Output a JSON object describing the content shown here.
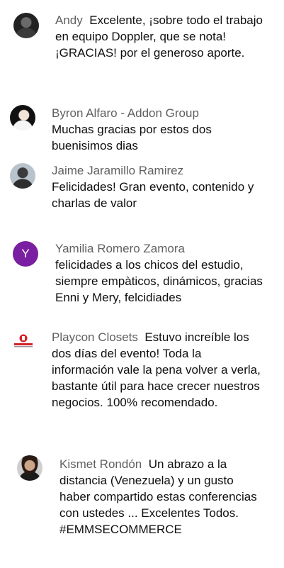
{
  "comments": [
    {
      "author": "Andy",
      "avatar": "user-photo",
      "text": "Excelente, ¡sobre todo el trabajo en equipo Doppler, que se nota! ¡GRACIAS! por el generoso aporte.",
      "layout": "inline"
    },
    {
      "author": "Byron Alfaro - Addon Group",
      "avatar": "user-photo",
      "text": "Muchas gracias por estos dos buenisimos dias",
      "layout": "block"
    },
    {
      "author": "Jaime Jaramillo Ramirez",
      "avatar": "user-photo",
      "text": "Felicidades! Gran evento, contenido y charlas de valor",
      "layout": "block"
    },
    {
      "author": "Yamilia Romero Zamora",
      "avatar_letter": "Y",
      "avatar_color": "#7b1fa2",
      "text": "felicidades a los chicos del estudio, siempre empàticos, dinámicos, gracias Enni y Mery, felcidiades",
      "layout": "block"
    },
    {
      "author": "Playcon Closets",
      "avatar": "company-logo",
      "text": "Estuvo increíble los dos días del evento! Toda la información vale la pena volver a verla, bastante útil para hace crecer nuestros negocios. 100% recomendado.",
      "layout": "inline"
    },
    {
      "author": "Kismet Rondón",
      "avatar": "user-photo",
      "text": "Un abrazo a la distancia (Venezuela) y un gusto haber compartido estas conferencias con ustedes ... Excelentes Todos. #EMMSECOMMERCE",
      "layout": "inline"
    }
  ],
  "colors": {
    "author": "#606060",
    "text": "#0f0f0f",
    "avatar_purple": "#7b1fa2"
  }
}
